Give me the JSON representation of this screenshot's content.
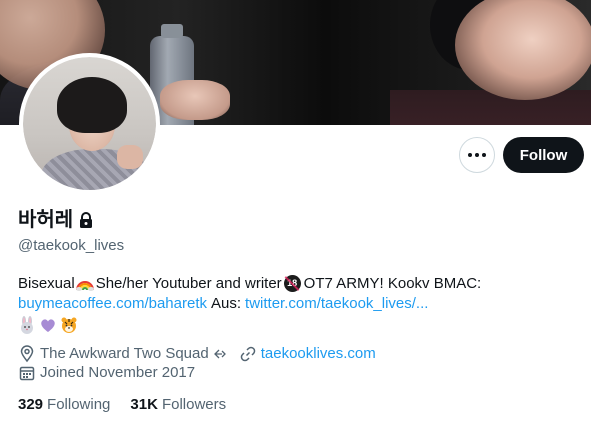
{
  "profile": {
    "display_name": "바허레",
    "handle": "@taekook_lives",
    "protected": true,
    "bio": {
      "line1_a": "Bisexual",
      "line1_b": "She/her Youtuber and writer",
      "line1_c": "OT7 ARMY! Kookv BMAC:",
      "line2_link1": "buymeacoffee.com/baharetk",
      "line2_text": "Aus:",
      "line2_link2": "twitter.com/taekook_lives/...",
      "emoji_icons": [
        "rabbit-emoji",
        "purple-heart-emoji",
        "tiger-emoji"
      ]
    },
    "location": "The Awkward Two Squad",
    "website": "taekooklives.com",
    "joined": "Joined November 2017",
    "following_count": "329",
    "following_label": "Following",
    "followers_count": "31K",
    "followers_label": "Followers"
  },
  "actions": {
    "follow_label": "Follow"
  },
  "colors": {
    "link": "#1d9bf0",
    "secondary_text": "#536471",
    "primary_text": "#0f1419",
    "follow_button_bg": "#0f1419"
  }
}
